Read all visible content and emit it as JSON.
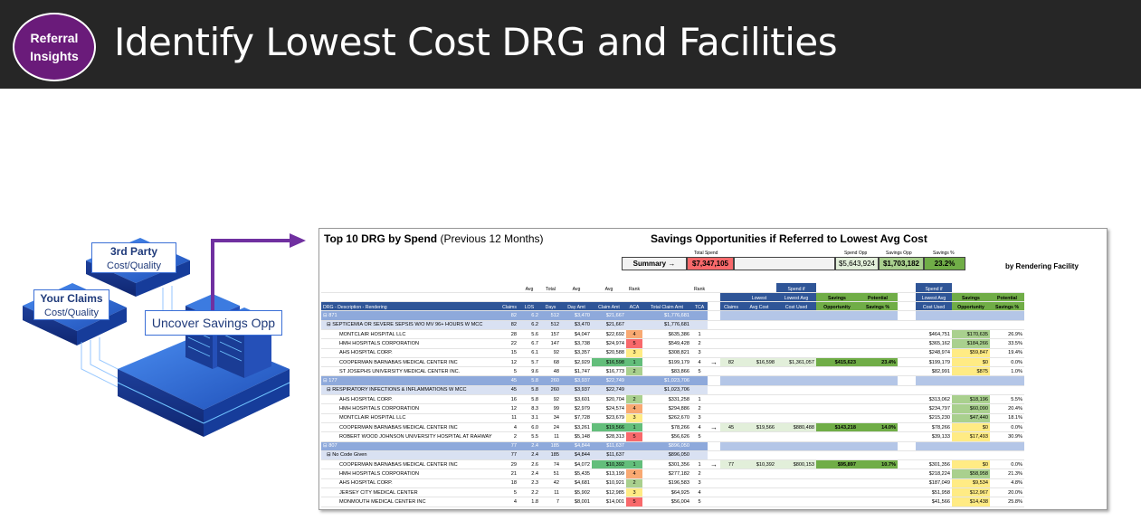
{
  "header": {
    "badge_line1": "Referral",
    "badge_line2": "Insights",
    "title": "Identify Lowest Cost DRG and Facilities"
  },
  "illustration": {
    "third_party_title": "3rd Party",
    "third_party_sub": "Cost/Quality",
    "claims_title": "Your Claims",
    "claims_sub": "Cost/Quality",
    "uncover": "Uncover Savings Opp"
  },
  "sheet": {
    "title_bold": "Top 10 DRG by Spend",
    "title_normal": "(Previous 12 Months)",
    "savings_title": "Savings Opportunities if Referred to Lowest Avg Cost",
    "by_facility": "by Rendering Facility",
    "summary": {
      "total_spend_label": "Total Spend",
      "spend_opp_label": "Spend Opp",
      "savings_opp_label": "Savings Opp",
      "savings_pct_label": "Savings %",
      "label": "Summary →",
      "total_spend": "$7,347,105",
      "spend_opp": "$5,643,924",
      "savings_opp": "$1,703,182",
      "savings_pct": "23.2%"
    },
    "columns": {
      "drg": "DRG - Description - Rendering",
      "claims": "Claims",
      "los": "LOS",
      "days": "Days",
      "day_amt": "Day Amt",
      "claim_amt": "Claim Amt",
      "aca": "ACA",
      "total_claim_amt": "Total Claim Amt",
      "tca": "TCA",
      "avg": "Avg",
      "total": "Total",
      "rank": "Rank",
      "r_claims": "Claims",
      "lowest": "Lowest",
      "avg_cost": "Avg Cost",
      "spend_if": "Spend if",
      "lowest_avg": "Lowest Avg",
      "cost_used": "Cost Used",
      "savings": "Savings",
      "opportunity": "Opportunity",
      "potential": "Potential",
      "savings_pct": "Savings %",
      "arrow": "→"
    },
    "rows": [
      {
        "type": "grp",
        "name": "⊟ 871",
        "claims": "82",
        "los": "6.2",
        "days": "512",
        "day": "$3,470",
        "claim": "$21,667",
        "aca": "",
        "total": "$1,776,681",
        "tca": ""
      },
      {
        "type": "sub",
        "name": "⊟ SEPTICEMIA OR SEVERE SEPSIS W/O MV 96+ HOURS W MCC",
        "claims": "82",
        "los": "6.2",
        "days": "512",
        "day": "$3,470",
        "claim": "$21,667",
        "aca": "",
        "total": "$1,776,681",
        "tca": ""
      },
      {
        "type": "fac",
        "name": "MONTCLAIR HOSPITAL LLC",
        "claims": "28",
        "los": "5.6",
        "days": "157",
        "day": "$4,047",
        "claim": "$22,692",
        "aca": "4",
        "acac": "o4",
        "total": "$635,386",
        "tca": "1",
        "f_spend": "$464,751",
        "f_sav": "$170,635",
        "f_savc": "g2",
        "f_pct": "26.9%"
      },
      {
        "type": "fac",
        "name": "HMH HOSPITALS CORPORATION",
        "claims": "22",
        "los": "6.7",
        "days": "147",
        "day": "$3,738",
        "claim": "$24,974",
        "aca": "5",
        "acac": "r5",
        "total": "$549,428",
        "tca": "2",
        "f_spend": "$365,162",
        "f_sav": "$184,266",
        "f_savc": "g2",
        "f_pct": "33.5%"
      },
      {
        "type": "fac",
        "name": "AHS HOSPITAL CORP.",
        "claims": "15",
        "los": "6.1",
        "days": "92",
        "day": "$3,357",
        "claim": "$20,588",
        "aca": "3",
        "acac": "y3",
        "total": "$308,821",
        "tca": "3",
        "f_spend": "$248,974",
        "f_sav": "$59,847",
        "f_savc": "y3",
        "f_pct": "19.4%"
      },
      {
        "type": "fac",
        "name": "COOPERMAN BARNABAS MEDICAL CENTER INC",
        "claims": "12",
        "los": "5.7",
        "days": "68",
        "day": "$2,929",
        "claim": "$16,598",
        "claimc": "g1",
        "aca": "1",
        "acac": "g1",
        "total": "$199,179",
        "tca": "4",
        "arrow": true,
        "r_claims": "82",
        "r_low": "$16,598",
        "r_spend": "$1,361,057",
        "r_sav": "$415,623",
        "r_pct": "23.4%",
        "f_spend": "$199,179",
        "f_sav": "$0",
        "f_savc": "y3",
        "f_pct": "0.0%"
      },
      {
        "type": "fac",
        "name": "ST JOSEPHS UNIVERSITY MEDICAL CENTER INC.",
        "claims": "5",
        "los": "9.6",
        "days": "48",
        "day": "$1,747",
        "claim": "$16,773",
        "aca": "2",
        "acac": "g2",
        "total": "$83,866",
        "tca": "5",
        "f_spend": "$82,991",
        "f_sav": "$875",
        "f_savc": "y3",
        "f_pct": "1.0%"
      },
      {
        "type": "grp",
        "name": "⊟ 177",
        "claims": "45",
        "los": "5.8",
        "days": "260",
        "day": "$3,937",
        "claim": "$22,749",
        "aca": "",
        "total": "$1,023,706",
        "tca": ""
      },
      {
        "type": "sub",
        "name": "⊟ RESPIRATORY INFECTIONS & INFLAMMATIONS W MCC",
        "claims": "45",
        "los": "5.8",
        "days": "260",
        "day": "$3,937",
        "claim": "$22,749",
        "aca": "",
        "total": "$1,023,706",
        "tca": ""
      },
      {
        "type": "fac",
        "name": "AHS HOSPITAL CORP.",
        "claims": "16",
        "los": "5.8",
        "days": "92",
        "day": "$3,601",
        "claim": "$20,704",
        "aca": "2",
        "acac": "g2",
        "total": "$331,258",
        "tca": "1",
        "f_spend": "$313,062",
        "f_sav": "$18,196",
        "f_savc": "g2",
        "f_pct": "5.5%"
      },
      {
        "type": "fac",
        "name": "HMH HOSPITALS CORPORATION",
        "claims": "12",
        "los": "8.3",
        "days": "99",
        "day": "$2,979",
        "claim": "$24,574",
        "aca": "4",
        "acac": "o4",
        "total": "$294,886",
        "tca": "2",
        "f_spend": "$234,797",
        "f_sav": "$60,090",
        "f_savc": "g2",
        "f_pct": "20.4%"
      },
      {
        "type": "fac",
        "name": "MONTCLAIR HOSPITAL LLC",
        "claims": "11",
        "los": "3.1",
        "days": "34",
        "day": "$7,728",
        "claim": "$23,679",
        "aca": "3",
        "acac": "y3",
        "total": "$262,670",
        "tca": "3",
        "f_spend": "$215,230",
        "f_sav": "$47,440",
        "f_savc": "g2",
        "f_pct": "18.1%"
      },
      {
        "type": "fac",
        "name": "COOPERMAN BARNABAS MEDICAL CENTER INC",
        "claims": "4",
        "los": "6.0",
        "days": "24",
        "day": "$3,261",
        "claim": "$19,566",
        "claimc": "g1",
        "aca": "1",
        "acac": "g1",
        "total": "$78,266",
        "tca": "4",
        "arrow": true,
        "r_claims": "45",
        "r_low": "$19,566",
        "r_spend": "$880,488",
        "r_sav": "$143,218",
        "r_pct": "14.0%",
        "f_spend": "$78,266",
        "f_sav": "$0",
        "f_savc": "y3",
        "f_pct": "0.0%"
      },
      {
        "type": "fac",
        "name": "ROBERT WOOD JOHNSON UNIVERSITY HOSPITAL AT RAHWAY",
        "claims": "2",
        "los": "5.5",
        "days": "11",
        "day": "$5,148",
        "claim": "$28,313",
        "aca": "5",
        "acac": "r5",
        "total": "$56,626",
        "tca": "5",
        "f_spend": "$39,133",
        "f_sav": "$17,493",
        "f_savc": "y3",
        "f_pct": "30.9%"
      },
      {
        "type": "grp",
        "name": "⊟ 807",
        "claims": "77",
        "los": "2.4",
        "days": "185",
        "day": "$4,844",
        "claim": "$11,637",
        "aca": "",
        "total": "$896,050",
        "tca": ""
      },
      {
        "type": "sub",
        "name": "⊟ No Code Given",
        "claims": "77",
        "los": "2.4",
        "days": "185",
        "day": "$4,844",
        "claim": "$11,637",
        "aca": "",
        "total": "$896,050",
        "tca": ""
      },
      {
        "type": "fac",
        "name": "COOPERMAN BARNABAS MEDICAL CENTER INC",
        "claims": "29",
        "los": "2.6",
        "days": "74",
        "day": "$4,072",
        "claim": "$10,392",
        "claimc": "g1",
        "aca": "1",
        "acac": "g1",
        "total": "$301,356",
        "tca": "1",
        "arrow": true,
        "r_claims": "77",
        "r_low": "$10,392",
        "r_spend": "$800,153",
        "r_sav": "$95,897",
        "r_pct": "10.7%",
        "f_spend": "$301,356",
        "f_sav": "$0",
        "f_savc": "y3",
        "f_pct": "0.0%"
      },
      {
        "type": "fac",
        "name": "HMH HOSPITALS CORPORATION",
        "claims": "21",
        "los": "2.4",
        "days": "51",
        "day": "$5,435",
        "claim": "$13,199",
        "aca": "4",
        "acac": "o4",
        "total": "$277,182",
        "tca": "2",
        "f_spend": "$218,224",
        "f_sav": "$58,958",
        "f_savc": "g2",
        "f_pct": "21.3%"
      },
      {
        "type": "fac",
        "name": "AHS HOSPITAL CORP.",
        "claims": "18",
        "los": "2.3",
        "days": "42",
        "day": "$4,681",
        "claim": "$10,921",
        "aca": "2",
        "acac": "g2",
        "total": "$196,583",
        "tca": "3",
        "f_spend": "$187,049",
        "f_sav": "$9,534",
        "f_savc": "y3",
        "f_pct": "4.8%"
      },
      {
        "type": "fac",
        "name": "JERSEY CITY MEDICAL CENTER",
        "claims": "5",
        "los": "2.2",
        "days": "11",
        "day": "$5,902",
        "claim": "$12,985",
        "aca": "3",
        "acac": "y3",
        "total": "$64,925",
        "tca": "4",
        "f_spend": "$51,958",
        "f_sav": "$12,967",
        "f_savc": "y3",
        "f_pct": "20.0%"
      },
      {
        "type": "fac",
        "name": "MONMOUTH MEDICAL CENTER INC",
        "claims": "4",
        "los": "1.8",
        "days": "7",
        "day": "$8,001",
        "claim": "$14,001",
        "aca": "5",
        "acac": "r5",
        "total": "$56,004",
        "tca": "5",
        "f_spend": "$41,566",
        "f_sav": "$14,438",
        "f_savc": "y3",
        "f_pct": "25.8%"
      }
    ]
  },
  "colors": {
    "header_bg": "#262626",
    "badge": "#6a1b7a",
    "arrow": "#7030a0",
    "best": "#63be7b",
    "worst": "#f8696b"
  }
}
